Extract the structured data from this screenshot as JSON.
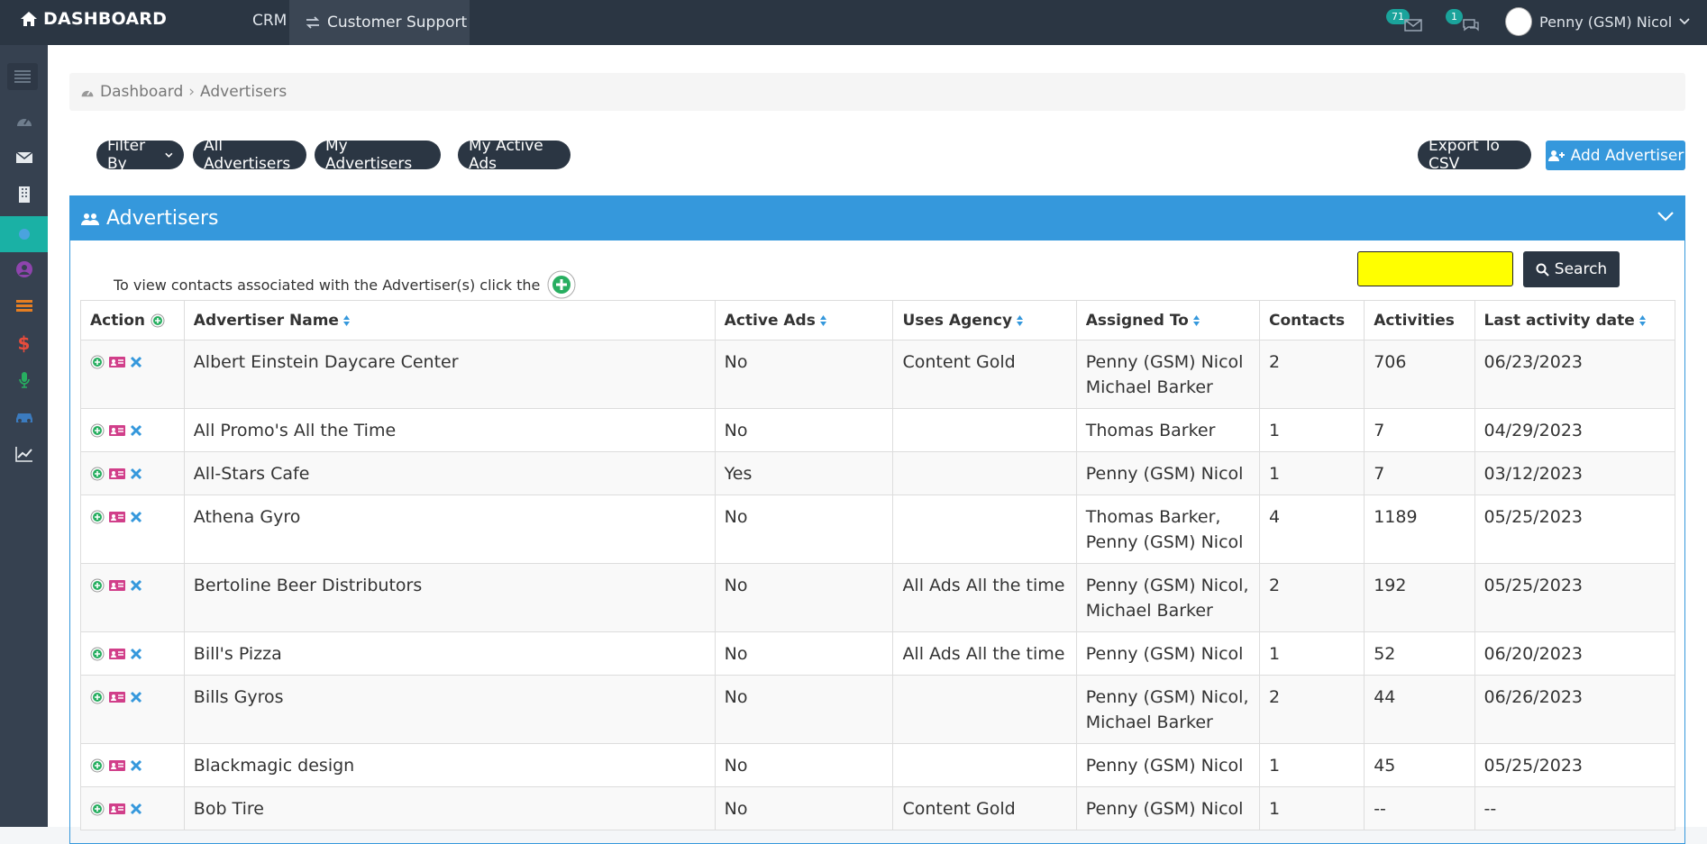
{
  "topbar": {
    "brand": "DASHBOARD",
    "nav_crm": "CRM",
    "nav_support": "Customer Support",
    "mail_count": "71",
    "chat_count": "1",
    "user_name": "Penny (GSM) Nicol"
  },
  "sidebar": {
    "icons": [
      "menu-icon",
      "dashboard-icon",
      "envelope-icon",
      "building-icon",
      "advertisers-icon",
      "user-circle-icon",
      "stack-icon",
      "dollar-icon",
      "microphone-icon",
      "car-icon",
      "chart-icon"
    ]
  },
  "breadcrumb": {
    "home": "Dashboard",
    "current": "Advertisers"
  },
  "toolbar": {
    "filter_by": "Filter By",
    "all_advertisers": "All Advertisers",
    "my_advertisers": "My Advertisers",
    "my_active_ads": "My Active Ads",
    "export_csv": "Export To CSV",
    "add_advertiser": "Add Advertiser"
  },
  "panel": {
    "title": "Advertisers",
    "info": "To view contacts associated with the Advertiser(s) click the",
    "search_label": "Search",
    "search_value": ""
  },
  "table": {
    "headers": {
      "action": "Action",
      "name": "Advertiser Name",
      "active_ads": "Active Ads",
      "uses_agency": "Uses Agency",
      "assigned_to": "Assigned To",
      "contacts": "Contacts",
      "activities": "Activities",
      "last_date": "Last activity date"
    },
    "rows": [
      {
        "name": "Albert Einstein Daycare Center",
        "active": "No",
        "agency": "Content Gold",
        "assigned1": "Penny (GSM) Nicol",
        "assigned2": "Michael Barker",
        "contacts": "2",
        "activities": "706",
        "date": "06/23/2023"
      },
      {
        "name": "All Promo's All the Time",
        "active": "No",
        "agency": "",
        "assigned1": "Thomas Barker",
        "assigned2": "",
        "contacts": "1",
        "activities": "7",
        "date": "04/29/2023"
      },
      {
        "name": "All-Stars Cafe",
        "active": "Yes",
        "agency": "",
        "assigned1": "Penny (GSM) Nicol",
        "assigned2": "",
        "contacts": "1",
        "activities": "7",
        "date": "03/12/2023"
      },
      {
        "name": "Athena Gyro",
        "active": "No",
        "agency": "",
        "assigned1": "Thomas Barker,",
        "assigned2": "Penny (GSM) Nicol",
        "contacts": "4",
        "activities": "1189",
        "date": "05/25/2023"
      },
      {
        "name": "Bertoline Beer Distributors",
        "active": "No",
        "agency": "All Ads All the time",
        "assigned1": "Penny (GSM) Nicol,",
        "assigned2": "Michael Barker",
        "contacts": "2",
        "activities": "192",
        "date": "05/25/2023"
      },
      {
        "name": "Bill's Pizza",
        "active": "No",
        "agency": "All Ads All the time",
        "assigned1": "Penny (GSM) Nicol",
        "assigned2": "",
        "contacts": "1",
        "activities": "52",
        "date": "06/20/2023"
      },
      {
        "name": "Bills Gyros",
        "active": "No",
        "agency": "",
        "assigned1": "Penny (GSM) Nicol,",
        "assigned2": "Michael Barker",
        "contacts": "2",
        "activities": "44",
        "date": "06/26/2023"
      },
      {
        "name": "Blackmagic design",
        "active": "No",
        "agency": "",
        "assigned1": "Penny (GSM) Nicol",
        "assigned2": "",
        "contacts": "1",
        "activities": "45",
        "date": "05/25/2023"
      },
      {
        "name": "Bob Tire",
        "active": "No",
        "agency": "Content Gold",
        "assigned1": "Penny (GSM) Nicol",
        "assigned2": "",
        "contacts": "1",
        "activities": "--",
        "date": "--"
      }
    ]
  }
}
